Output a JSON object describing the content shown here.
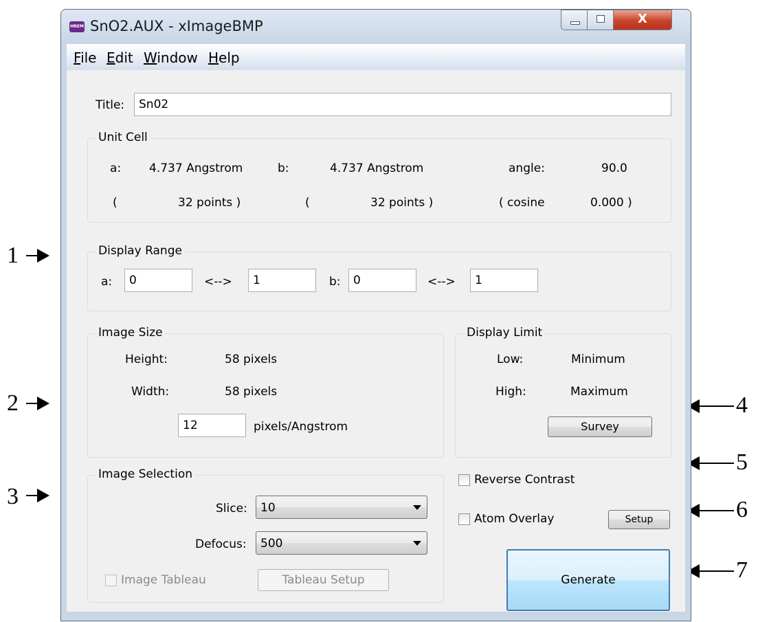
{
  "window": {
    "title": "SnO2.AUX - xImageBMP",
    "app_icon_text": "HREM",
    "close_glyph": "X"
  },
  "menu": {
    "items": [
      {
        "accel": "F",
        "rest": "ile"
      },
      {
        "accel": "E",
        "rest": "dit"
      },
      {
        "accel": "W",
        "rest": "indow"
      },
      {
        "accel": "H",
        "rest": "elp"
      }
    ]
  },
  "title_field": {
    "label": "Title:",
    "value": "Sn02"
  },
  "unit_cell": {
    "group_title": "Unit Cell",
    "a_label": "a:",
    "a_value": "4.737 Angstrom",
    "b_label": "b:",
    "b_value": "4.737 Angstrom",
    "angle_label": "angle:",
    "angle_value": "90.0",
    "open_paren_a": "(",
    "a_points": "32  points )",
    "open_paren_b": "(",
    "b_points": "32  points )",
    "cosine_label": "( cosine",
    "cosine_value": "0.000 )"
  },
  "display_range": {
    "group_title": "Display Range",
    "a_label": "a:",
    "a_from": "0",
    "a_arrow": "<-->",
    "a_to": "1",
    "b_label": "b:",
    "b_from": "0",
    "b_arrow": "<-->",
    "b_to": "1"
  },
  "image_size": {
    "group_title": "Image Size",
    "height_label": "Height:",
    "height_value": "58 pixels",
    "width_label": "Width:",
    "width_value": "58 pixels",
    "scale_value": "12",
    "scale_unit": "pixels/Angstrom"
  },
  "display_limit": {
    "group_title": "Display Limit",
    "low_label": "Low:",
    "low_value": "Minimum",
    "high_label": "High:",
    "high_value": "Maximum",
    "survey_label": "Survey"
  },
  "image_selection": {
    "group_title": "Image Selection",
    "slice_label": "Slice:",
    "slice_value": "10",
    "defocus_label": "Defocus:",
    "defocus_value": "500",
    "tableau_label": "Image Tableau",
    "tableau_setup_label": "Tableau Setup"
  },
  "options": {
    "reverse_contrast_label": "Reverse Contrast",
    "reverse_contrast_checked": false,
    "atom_overlay_label": "Atom Overlay",
    "atom_overlay_checked": false,
    "setup_label": "Setup",
    "generate_label": "Generate"
  },
  "callouts": [
    "1",
    "2",
    "3",
    "4",
    "5",
    "6",
    "7"
  ]
}
